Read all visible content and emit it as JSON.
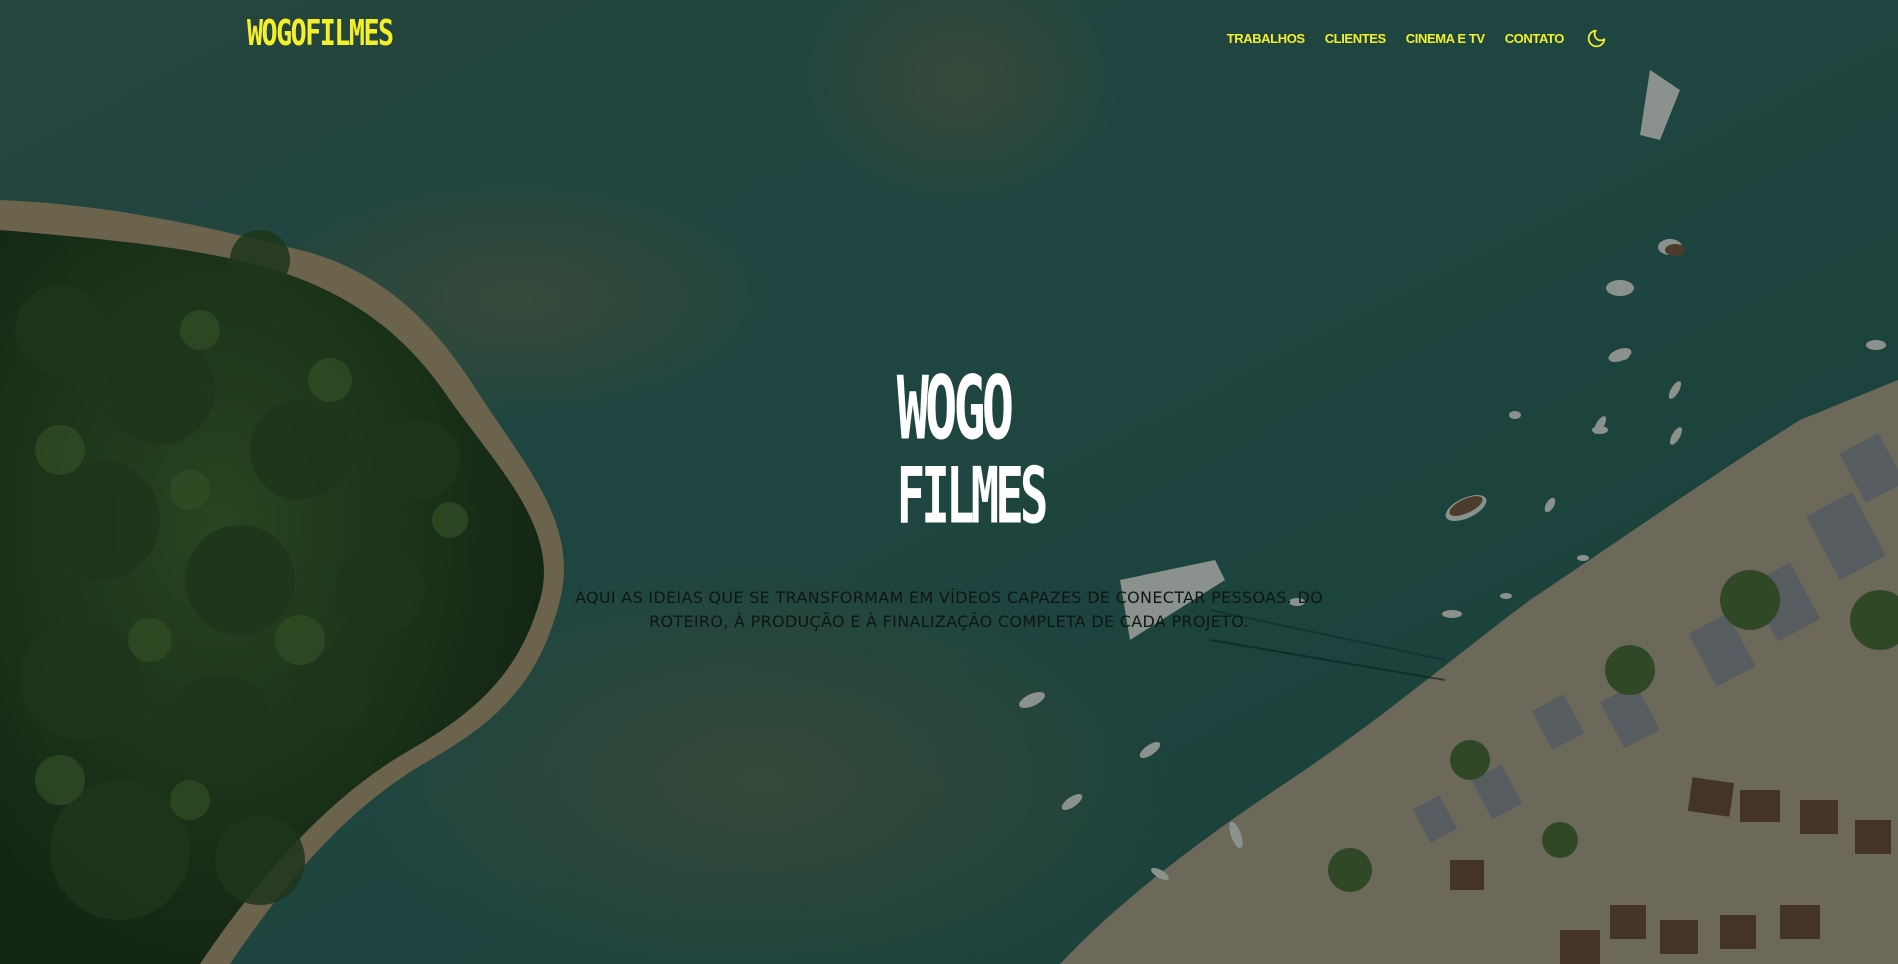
{
  "header": {
    "brand": "WOGOFILMES",
    "nav": [
      {
        "label": "TRABALHOS"
      },
      {
        "label": "CLIENTES"
      },
      {
        "label": "CINEMA E TV"
      },
      {
        "label": "CONTATO"
      }
    ],
    "theme_toggle_icon": "moon-icon"
  },
  "hero": {
    "logo_line1": "WOGO",
    "logo_line2": "FILMES",
    "tagline": "AQUI AS IDEIAS QUE SE TRANSFORMAM EM VÍDEOS CAPAZES DE CONECTAR PESSOAS. DO ROTEIRO, À PRODUÇÃO E À FINALIZAÇÃO COMPLETA DE CADA PROJETO.",
    "background": "aerial-coast-photo"
  },
  "colors": {
    "accent": "#f3ef2a",
    "logo": "#ffffff",
    "tagline": "#0e1714"
  }
}
